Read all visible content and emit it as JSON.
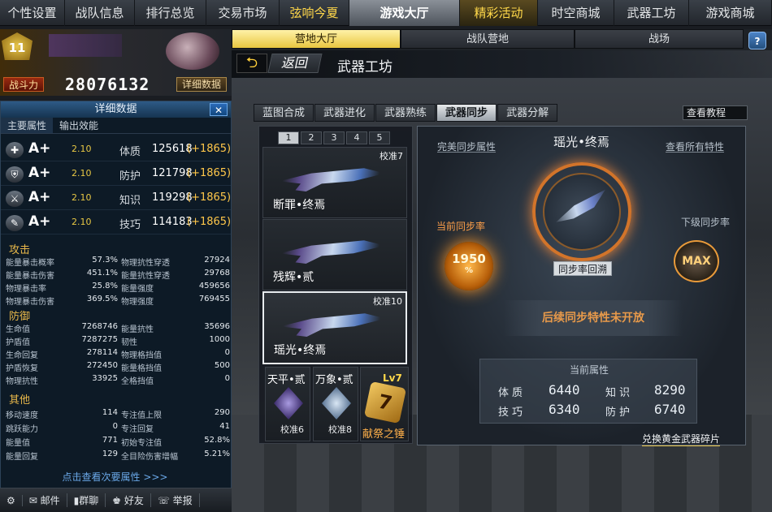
{
  "topnav": [
    "个性设置",
    "战队信息",
    "排行总览",
    "交易市场",
    "弦响今夏",
    "游戏大厅",
    "精彩活动",
    "时空商城",
    "武器工坊",
    "游戏商城"
  ],
  "subtabs": [
    "营地大厅",
    "战队营地",
    "战场"
  ],
  "help": "?",
  "back": {
    "arrow": "⮌",
    "label": "返回"
  },
  "page_title": "武器工坊",
  "profile": {
    "level": "11",
    "power_label": "战斗力",
    "power_value": "28076132",
    "detail_button": "详细数据"
  },
  "panel": {
    "title": "详细数据",
    "close": "✕",
    "tabs": [
      "主要属性",
      "输出效能"
    ],
    "main_attrs": [
      {
        "icon": "✚",
        "grade": "A+",
        "score": "2.10",
        "name": "体质",
        "value": "125618",
        "bonus": "(+1865)"
      },
      {
        "icon": "⛨",
        "grade": "A+",
        "score": "2.10",
        "name": "防护",
        "value": "121798",
        "bonus": "(+1865)"
      },
      {
        "icon": "⚔",
        "grade": "A+",
        "score": "2.10",
        "name": "知识",
        "value": "119298",
        "bonus": "(+1865)"
      },
      {
        "icon": "✎",
        "grade": "A+",
        "score": "2.10",
        "name": "技巧",
        "value": "114183",
        "bonus": "(+1865)"
      }
    ],
    "sections": {
      "attack": {
        "title": "攻击",
        "rows": [
          [
            "能量暴击概率",
            "57.3%",
            "物理抗性穿透",
            "27924"
          ],
          [
            "能量暴击伤害",
            "451.1%",
            "能量抗性穿透",
            "29768"
          ],
          [
            "物理暴击率",
            "25.8%",
            "能量强度",
            "459656"
          ],
          [
            "物理暴击伤害",
            "369.5%",
            "物理强度",
            "769455"
          ]
        ]
      },
      "defense": {
        "title": "防御",
        "rows": [
          [
            "生命值",
            "7268746",
            "能量抗性",
            "35696"
          ],
          [
            "护盾值",
            "7287275",
            "韧性",
            "1000"
          ],
          [
            "生命回复",
            "278114",
            "物理格挡值",
            "0"
          ],
          [
            "护盾恢复",
            "272450",
            "能量格挡值",
            "500"
          ],
          [
            "物理抗性",
            "33925",
            "全格挡值",
            "0"
          ]
        ]
      },
      "other": {
        "title": "其他",
        "rows": [
          [
            "移动速度",
            "114",
            "专注值上限",
            "290"
          ],
          [
            "跳跃能力",
            "0",
            "专注回复",
            "41"
          ],
          [
            "能量值",
            "771",
            "初始专注值",
            "52.8%"
          ],
          [
            "能量回复",
            "129",
            "全目险伤害增幅",
            "5.21%"
          ]
        ]
      }
    },
    "more_link": "点击查看次要属性 >>>"
  },
  "footer": [
    "⚙",
    "✉ 邮件",
    "▮群聊",
    "♚ 好友",
    "☏ 举报"
  ],
  "weapon_tabs": [
    "蓝图合成",
    "武器进化",
    "武器熟练",
    "武器同步",
    "武器分解"
  ],
  "tutorial": "查看教程",
  "pager": [
    "1",
    "2",
    "3",
    "4",
    "5"
  ],
  "weapons": [
    {
      "name": "断罪•终焉",
      "cal": "校准7"
    },
    {
      "name": "残辉•贰",
      "cal": ""
    },
    {
      "name": "瑶光•终焉",
      "cal": "校准10"
    }
  ],
  "small_cards": [
    {
      "name": "天平•贰",
      "cal": "校准6"
    },
    {
      "name": "万象•贰",
      "cal": "校准8"
    }
  ],
  "hammer": {
    "level": "Lv7",
    "name": "献祭之锤",
    "glyph": "7"
  },
  "sync": {
    "title": "瑶光•终焉",
    "perfect_btn": "完美同步属性",
    "all_traits_btn": "查看所有特性",
    "current_label": "当前同步率",
    "current_value": "1950",
    "current_unit": "%",
    "next_label": "下级同步率",
    "next_value": "MAX",
    "rollback_btn": "同步率回溯",
    "not_open": "后续同步特性未开放",
    "current_attrs_title": "当前属性",
    "attrs": [
      {
        "k": "体质",
        "v": "6440"
      },
      {
        "k": "知识",
        "v": "8290"
      },
      {
        "k": "技巧",
        "v": "6340"
      },
      {
        "k": "防护",
        "v": "6740"
      }
    ],
    "exchange": "兑换黄金武器碎片"
  }
}
